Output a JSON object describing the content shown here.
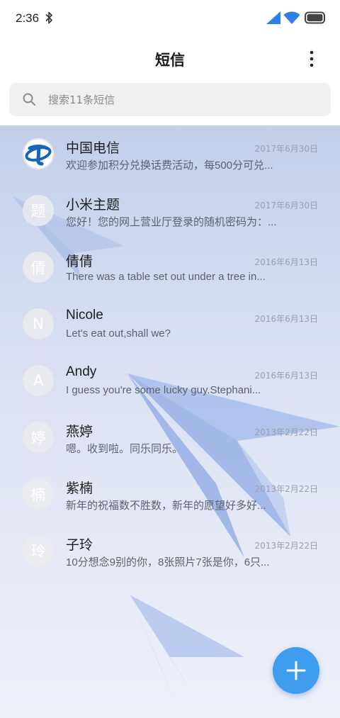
{
  "status_bar": {
    "time": "2:36",
    "icons": [
      "bluetooth-icon",
      "signal-icon",
      "wifi-icon",
      "battery-icon"
    ]
  },
  "header": {
    "title": "短信",
    "menu_icon": "more-vert-icon"
  },
  "search": {
    "placeholder": "搜索11条短信",
    "icon": "search-icon"
  },
  "colors": {
    "accent": "#3f9df0",
    "list_background": "#d4dcf0"
  },
  "conversations": [
    {
      "avatar": "",
      "avatar_type": "china-telecom-logo",
      "name": "中国电信",
      "date": "2017年6月30日",
      "preview": "欢迎参加积分兑换话费活动，每500分可兑..."
    },
    {
      "avatar": "题",
      "name": "小米主题",
      "date": "2017年6月30日",
      "preview": "您好！您的网上营业厅登录的随机密码为：..."
    },
    {
      "avatar": "倩",
      "name": "倩倩",
      "date": "2016年6月13日",
      "preview": "There was a table set out under a tree in..."
    },
    {
      "avatar": "N",
      "name": "Nicole",
      "date": "2016年6月13日",
      "preview": "Let's eat out,shall we?"
    },
    {
      "avatar": "A",
      "name": "Andy",
      "date": "2016年6月13日",
      "preview": "I guess you're some lucky guy.Stephani..."
    },
    {
      "avatar": "婷",
      "name": "燕婷",
      "date": "2013年2月22日",
      "preview": "嗯。收到啦。同乐同乐。"
    },
    {
      "avatar": "楠",
      "name": "紫楠",
      "date": "2013年2月22日",
      "preview": "新年的祝福数不胜数，新年的愿望好多好..."
    },
    {
      "avatar": "玲",
      "name": "子玲",
      "date": "2013年2月22日",
      "preview": "10分想念9别的你，8张照片7张是你，6只..."
    }
  ],
  "fab": {
    "icon": "plus-icon"
  }
}
